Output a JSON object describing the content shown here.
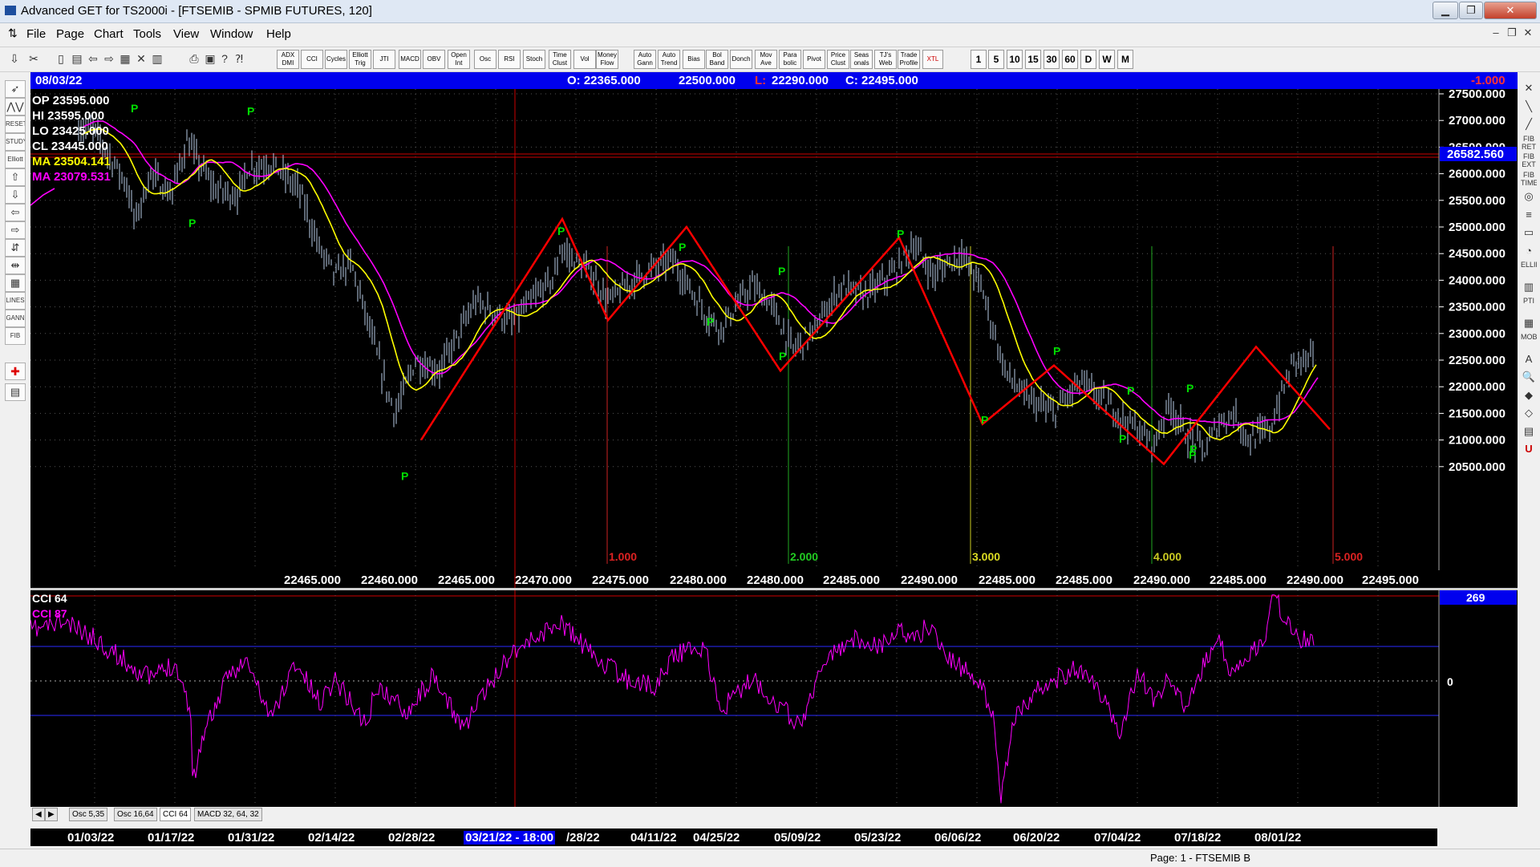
{
  "title_bar": {
    "title": "Advanced GET for TS2000i - [FTSEMIB - SPMIB FUTURES, 120]",
    "minimize": "▁",
    "maximize": "❐",
    "close": "✕"
  },
  "menu": [
    "File",
    "Page",
    "Chart",
    "Tools",
    "View",
    "Window",
    "Help"
  ],
  "mdi_controls": [
    "–",
    "❐",
    "✕"
  ],
  "toolbar": {
    "studies": [
      "ADX DMI",
      "CCI",
      "Cycles",
      "Elliott Trig",
      "JTI",
      "MACD",
      "OBV",
      "Open Int",
      "Osc",
      "RSI",
      "Stoch",
      "Time Clust",
      "Vol",
      "Money Flow",
      "Auto Gann",
      "Auto Trend",
      "Bias",
      "Bol Band",
      "Donch",
      "Mov Ave",
      "Para bolic",
      "Pivot",
      "Price Clust",
      "Seas onals",
      "TJ's Web",
      "Trade Profile",
      "XTL"
    ],
    "intervals": [
      "1",
      "5",
      "10",
      "15",
      "30",
      "60",
      "D",
      "W",
      "M"
    ]
  },
  "left_tools": [
    "➶",
    "⋀⋁",
    "RESET",
    "STUDY",
    "Elliott",
    "⇧",
    "⇩",
    "⇦",
    "⇨",
    "⇵",
    "⇹",
    "▦",
    "LINES",
    "GANN",
    "FIB",
    "✚",
    "▤"
  ],
  "right_tools": [
    "✕",
    "╲",
    "╱",
    "FIB RET",
    "FIB EXT",
    "FIB TIME",
    "◎",
    "≡",
    "▭",
    "◔",
    "ELLIPS",
    "▥",
    "PTI",
    "▦",
    "MOB",
    "A",
    "🔍",
    "◆",
    "◇",
    "▤",
    "U"
  ],
  "info_bar": {
    "date": "08/03/22",
    "open": "O: 22365.000",
    "high": "22500.000",
    "low_label": "L:",
    "low": "22290.000",
    "close": "C: 22495.000",
    "change": "-1.000"
  },
  "legend": {
    "op": "OP  23595.000",
    "hi": "HI   23595.000",
    "lo": "LO  23425.000",
    "cl": "CL  23445.000",
    "ma1": "MA  23504.141",
    "ma2": "MA  23079.531"
  },
  "price_axis": [
    "27500.000",
    "27000.000",
    "26500.000",
    "26000.000",
    "25500.000",
    "25000.000",
    "24500.000",
    "24000.000",
    "23500.000",
    "23000.000",
    "22500.000",
    "22000.000",
    "21500.000",
    "21000.000",
    "20500.000"
  ],
  "current_price_tag": "26582.560",
  "bottom_values": [
    "22465.000",
    "22460.000",
    "22465.000",
    "22470.000",
    "22475.000",
    "22480.000",
    "22480.000",
    "22485.000",
    "22490.000",
    "22485.000",
    "22485.000",
    "22490.000",
    "22485.000",
    "22490.000",
    "22495.000"
  ],
  "time_markers": [
    "1.000",
    "2.000",
    "3.000",
    "4.000",
    "5.000"
  ],
  "pivot_label": "P",
  "cci": {
    "label1": "CCI 64",
    "label2": "CCI  87",
    "value_tag": "269",
    "zero_label": "0"
  },
  "tabs": [
    "Osc 5,35",
    "Osc 16,64",
    "CCI 64",
    "MACD 32, 64, 32"
  ],
  "tab_nav": [
    "◀",
    "▶"
  ],
  "dates": [
    "01/03/22",
    "01/17/22",
    "01/31/22",
    "02/14/22",
    "02/28/22",
    "03/21/22 - 18:00",
    "/28/22",
    "04/11/22",
    "04/25/22",
    "05/09/22",
    "05/23/22",
    "06/06/22",
    "06/20/22",
    "07/04/22",
    "07/18/22",
    "08/01/22"
  ],
  "status": "Page: 1 - FTSEMIB B",
  "colors": {
    "info_bar": "#0000ee",
    "chart_bg": "#000000",
    "zigzag": "#ff0000",
    "ma_fast": "#ffff00",
    "ma_slow": "#ff00ff",
    "bars": "#b8cbe6",
    "pivot": "#00dd00",
    "cci": "#ff00ff"
  }
}
